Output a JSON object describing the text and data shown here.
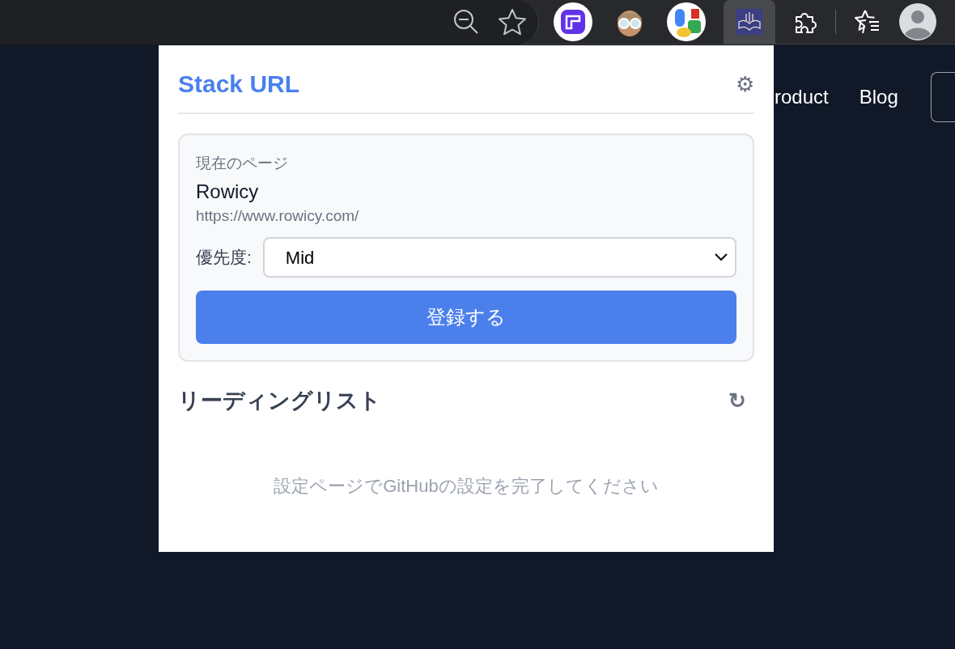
{
  "page_nav": [
    "roduct",
    "Blog"
  ],
  "popup": {
    "title": "Stack URL",
    "settings_glyph": "⚙",
    "current_page": {
      "label": "現在のページ",
      "title": "Rowicy",
      "url": "https://www.rowicy.com/"
    },
    "priority": {
      "label": "優先度:",
      "value": "Mid"
    },
    "register_button": "登録する",
    "reading_list": {
      "heading": "リーディングリスト",
      "refresh_glyph": "↻",
      "empty_message": "設定ページでGitHubの設定を完了してください"
    }
  }
}
